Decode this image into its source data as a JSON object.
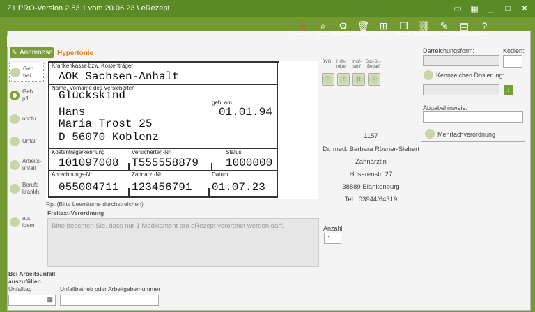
{
  "window": {
    "title": "Z1.PRO-Version 2.83.1 vom 20.06.23 \\ eRezept"
  },
  "toolbar": [
    {
      "label": "Beenden",
      "icon": "close-circle-icon"
    },
    {
      "label": "Suchen",
      "icon": "search-icon"
    },
    {
      "label": "Konfiguration",
      "icon": "gear-icon"
    },
    {
      "label": "Löschen",
      "icon": "trash-icon"
    },
    {
      "label": "Neu",
      "icon": "new-folder-icon"
    },
    {
      "label": "Historie",
      "icon": "history-icon"
    },
    {
      "label": "Fertigarznei",
      "icon": "link-icon"
    },
    {
      "label": "Versand",
      "icon": "send-icon"
    },
    {
      "label": "Rezeptkategorie",
      "icon": "category-icon"
    },
    {
      "label": "Hilfe",
      "icon": "help-icon"
    }
  ],
  "anamnese_label": "Anamnese",
  "diagnosis": "Hypertonie",
  "left_options": [
    {
      "label": "Geb. frei",
      "checked": false
    },
    {
      "label": "Geb. pfl.",
      "checked": true
    },
    {
      "label": "noctu",
      "checked": false
    },
    {
      "label": "Unfall",
      "checked": false
    },
    {
      "label": "Arbeits-unfall",
      "checked": false
    },
    {
      "label": "Berufs-krankh.",
      "checked": false
    },
    {
      "label": "aut. idem",
      "checked": false
    }
  ],
  "form": {
    "kasse_label": "Krankenkasse bzw. Kostenträger",
    "kasse": "AOK Sachsen-Anhalt",
    "name_label": "Name, Vorname des Versicherten",
    "nachname": "Glückskind",
    "geb_label": "geb. am",
    "vorname": "Hans",
    "geb": "01.01.94",
    "strasse": "Maria Trost 25",
    "ort": "D 56070 Koblenz",
    "ktk_label": "Kostenträgerkennung",
    "ktk": "101097008",
    "vnr_label": "Versicherten-Nr.",
    "vnr": "T555558879",
    "status_label": "Status",
    "status": "1000000",
    "abr_label": "Abrechnungs-Nr.",
    "abr": "055004711",
    "zanr_label": "Zahnarzt-Nr.",
    "zanr": "123456791",
    "datum_label": "Datum",
    "datum": "01.07.23"
  },
  "columns": [
    {
      "label": "BVG",
      "num": "6"
    },
    {
      "label": "Hilfs-mittel",
      "num": "7"
    },
    {
      "label": "Impf-stoff",
      "num": "8"
    },
    {
      "label": "Spr.-St.-Bedarf",
      "num": "9"
    }
  ],
  "doctor": {
    "id": "1157",
    "name": "Dr. med.  Barbara Rösner-Siebert",
    "title": "Zahnärztin",
    "street": "Husarenstr. 27",
    "city": "38889 Blankenburg",
    "tel": "Tel.: 03944/64319"
  },
  "rp": "Rp. (Bitte Leerräume durchstreichen)",
  "freitext_label": "Freitext-Verordnung",
  "freitext": "Bitte beachten Sie, dass nur 1 Medikament pro eRezept verordnet werden darf.",
  "anzahl_label": "Anzahl",
  "anzahl": "1",
  "right": {
    "darreichung": "Darreichungsform:",
    "kodiert": "Kodiert:",
    "dosierung": "Kennzeichen Dosierung:",
    "abgabe": "Abgabehinweis:",
    "mehrfach": "Mehrfachverordnung"
  },
  "bottom": {
    "heading1": "Bei Arbeitsunfall",
    "heading2": "auszufüllen",
    "unfalltag": "Unfalltag",
    "betrieb": "Unfallbetrieb oder Arbeitgebernummer"
  }
}
